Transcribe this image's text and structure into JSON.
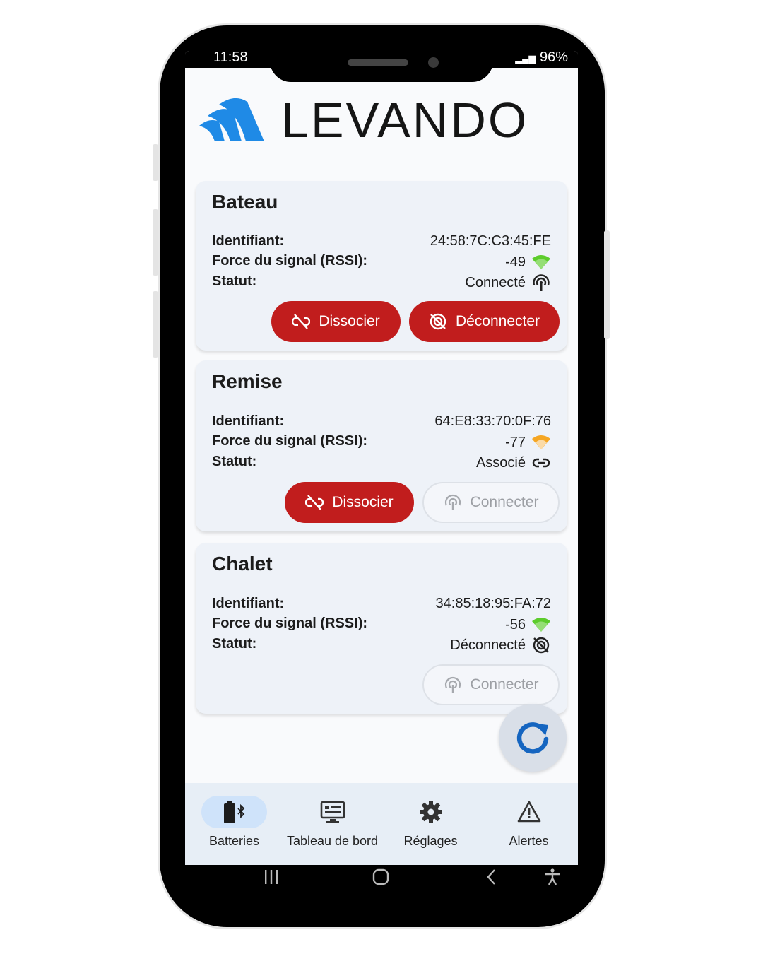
{
  "status_bar": {
    "time": "11:58",
    "battery": "96%"
  },
  "app": {
    "logo_text": "LEVANDO",
    "brand_color": "#1f8ae6"
  },
  "labels": {
    "id": "Identifiant:",
    "rssi": "Force du signal (RSSI):",
    "status": "Statut:"
  },
  "devices": [
    {
      "name": "Bateau",
      "id": "24:58:7C:C3:45:FE",
      "rssi": "-49",
      "signal_color": "#5ccc2c",
      "status": "Connecté",
      "status_icon": "connected-icon",
      "buttons": [
        {
          "label": "Dissocier",
          "style": "red"
        },
        {
          "label": "Déconnecter",
          "style": "red"
        }
      ]
    },
    {
      "name": "Remise",
      "id": "64:E8:33:70:0F:76",
      "rssi": "-77",
      "signal_color": "#f5a623",
      "status": "Associé",
      "status_icon": "link-icon",
      "buttons": [
        {
          "label": "Dissocier",
          "style": "red"
        },
        {
          "label": "Connecter",
          "style": "disabled"
        }
      ]
    },
    {
      "name": "Chalet",
      "id": "34:85:18:95:FA:72",
      "rssi": "-56",
      "signal_color": "#5ccc2c",
      "status": "Déconnecté",
      "status_icon": "disconnected-icon",
      "buttons": [
        {
          "label": "Connecter",
          "style": "disabled"
        }
      ]
    }
  ],
  "nav": [
    {
      "label": "Batteries",
      "icon": "battery-bluetooth-icon",
      "active": true
    },
    {
      "label": "Tableau de bord",
      "icon": "dashboard-icon",
      "active": false
    },
    {
      "label": "Réglages",
      "icon": "gear-icon",
      "active": false
    },
    {
      "label": "Alertes",
      "icon": "warning-icon",
      "active": false
    }
  ],
  "colors": {
    "accent_red": "#c11d1d",
    "refresh_blue": "#1565c0"
  }
}
